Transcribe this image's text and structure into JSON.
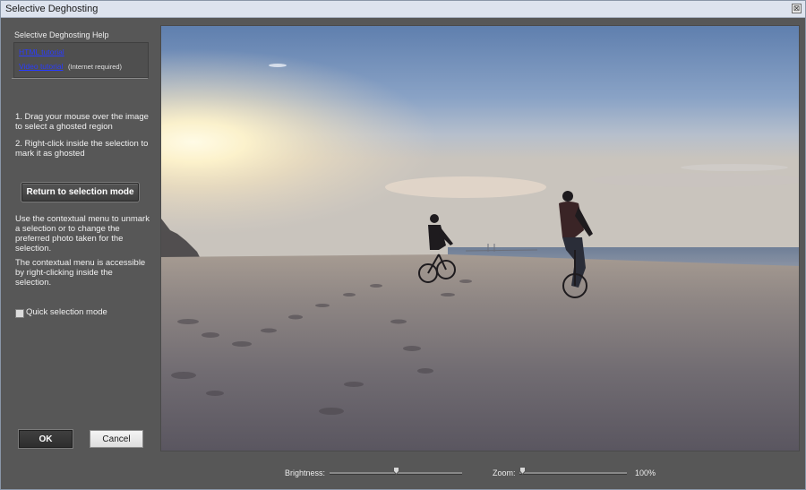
{
  "window": {
    "title": "Selective Deghosting",
    "close_glyph": "⊠"
  },
  "help": {
    "title": "Selective Deghosting Help",
    "html_tutorial": "HTML tutorial",
    "video_tutorial": "Video tutorial",
    "internet_note": "(Internet required)"
  },
  "instructions": {
    "step1": "1. Drag your  mouse over the image to select a ghosted region",
    "step2": "2. Right-click inside the selection to mark it as ghosted"
  },
  "return_button": "Return to selection mode",
  "info": {
    "contextual": "Use the contextual menu to unmark a selection or to change the preferred photo taken for the selection.",
    "accessible": "The contextual menu is accessible by right-clicking inside the selection."
  },
  "quick_selection": {
    "label": "Quick selection mode",
    "checked": false
  },
  "buttons": {
    "ok": "OK",
    "cancel": "Cancel"
  },
  "bottom": {
    "brightness_label": "Brightness:",
    "brightness_level": 0.5,
    "zoom_label": "Zoom:",
    "zoom_level": 0,
    "zoom_value": "100%"
  },
  "photo": {
    "description_icon": "beach-sunset-cyclists-image"
  },
  "colors": {
    "panel_bg": "#575757",
    "link": "#2a3bff",
    "titlebar": "#dde3ee"
  }
}
